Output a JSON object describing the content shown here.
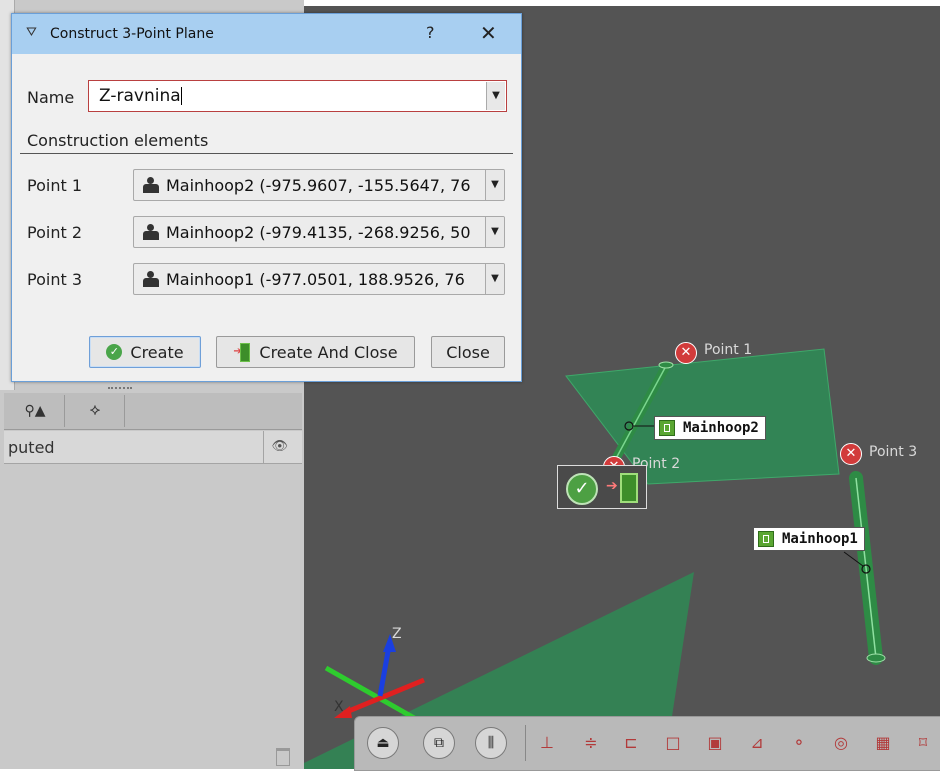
{
  "dialog": {
    "title": "Construct 3-Point Plane",
    "help_label": "?",
    "close_label": "✕",
    "name_label": "Name",
    "name_value": "Z-ravnina",
    "section_label": "Construction elements",
    "points": [
      {
        "label": "Point 1",
        "value": "Mainhoop2 (-975.9607, -155.5647, 76"
      },
      {
        "label": "Point 2",
        "value": "Mainhoop2 (-979.4135, -268.9256, 50"
      },
      {
        "label": "Point 3",
        "value": "Mainhoop1 (-977.0501, 188.9526, 76"
      }
    ],
    "buttons": {
      "create": "Create",
      "create_and_close": "Create And Close",
      "close": "Close"
    }
  },
  "left_panel": {
    "tree_header": "puted",
    "tabs": [
      "⚲▲",
      "⯎"
    ]
  },
  "viewport": {
    "labels": {
      "mainhoop2": "Mainhoop2",
      "mainhoop1": "Mainhoop1",
      "point1": "Point 1",
      "point2": "Point 2",
      "point3": "Point 3"
    },
    "axis_z": "Z",
    "axis_x": "X"
  },
  "colors": {
    "plane_green": "#2f8a55",
    "tube_green": "#2e8b45",
    "viewport_bg": "#545454",
    "dialog_title_bg": "#a8cff1",
    "error_red": "#d23b3b"
  },
  "icons": {
    "create": "check-circle-icon",
    "create_and_close": "exit-door-icon",
    "point": "person-icon"
  }
}
